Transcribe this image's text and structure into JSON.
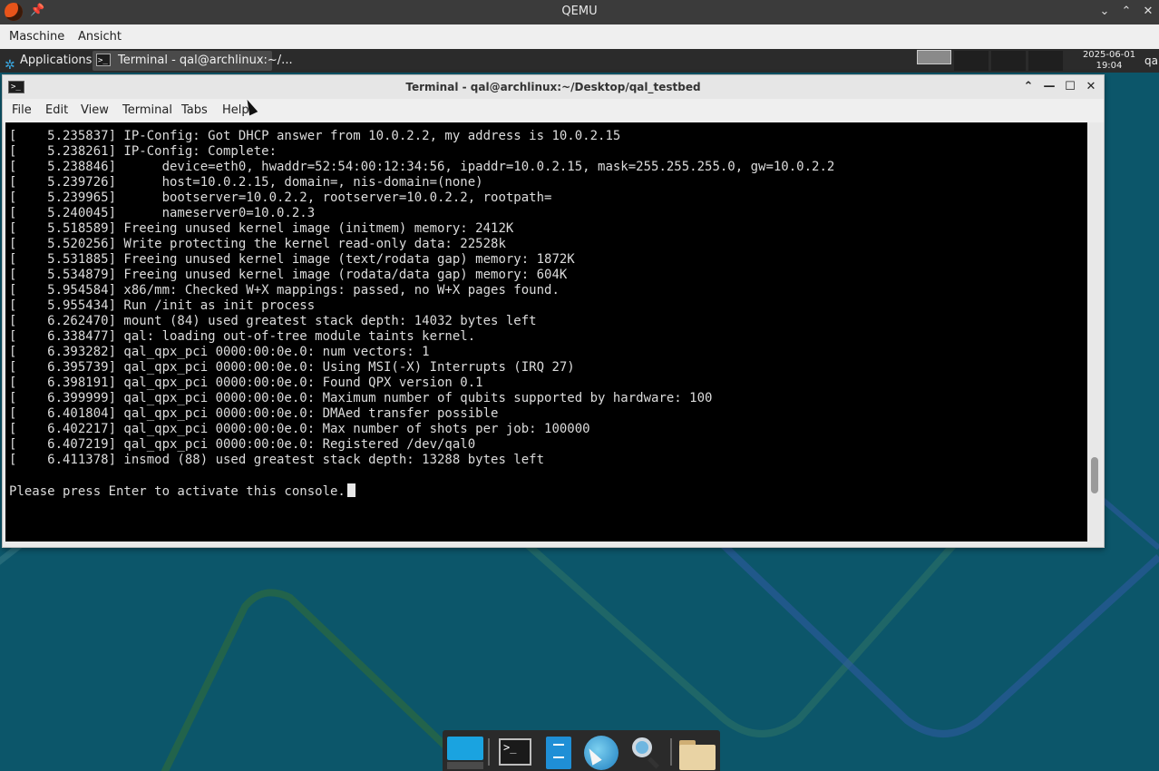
{
  "qemu": {
    "title": "QEMU",
    "pin_icon": "pin-icon",
    "menu": [
      "Maschine",
      "Ansicht"
    ],
    "controls": {
      "minimize": "⌄",
      "maximize": "⌃",
      "close": "✕"
    }
  },
  "panel": {
    "applications_label": "Applications",
    "task_label": "Terminal - qal@archlinux:~/...",
    "clock": {
      "date": "2025-06-01",
      "time": "19:04"
    },
    "user": "qa"
  },
  "terminal": {
    "title": "Terminal - qal@archlinux:~/Desktop/qal_testbed",
    "menu": [
      "File",
      "Edit",
      "View",
      "Terminal",
      "Tabs",
      "Help"
    ],
    "controls": {
      "shade": "⌃",
      "minimize": "—",
      "maximize": "☐",
      "close": "✕"
    },
    "lines": [
      "[    5.235837] IP-Config: Got DHCP answer from 10.0.2.2, my address is 10.0.2.15",
      "[    5.238261] IP-Config: Complete:",
      "[    5.238846]      device=eth0, hwaddr=52:54:00:12:34:56, ipaddr=10.0.2.15, mask=255.255.255.0, gw=10.0.2.2",
      "[    5.239726]      host=10.0.2.15, domain=, nis-domain=(none)",
      "[    5.239965]      bootserver=10.0.2.2, rootserver=10.0.2.2, rootpath=",
      "[    5.240045]      nameserver0=10.0.2.3",
      "[    5.518589] Freeing unused kernel image (initmem) memory: 2412K",
      "[    5.520256] Write protecting the kernel read-only data: 22528k",
      "[    5.531885] Freeing unused kernel image (text/rodata gap) memory: 1872K",
      "[    5.534879] Freeing unused kernel image (rodata/data gap) memory: 604K",
      "[    5.954584] x86/mm: Checked W+X mappings: passed, no W+X pages found.",
      "[    5.955434] Run /init as init process",
      "[    6.262470] mount (84) used greatest stack depth: 14032 bytes left",
      "[    6.338477] qal: loading out-of-tree module taints kernel.",
      "[    6.393282] qal_qpx_pci 0000:00:0e.0: num vectors: 1",
      "[    6.395739] qal_qpx_pci 0000:00:0e.0: Using MSI(-X) Interrupts (IRQ 27)",
      "[    6.398191] qal_qpx_pci 0000:00:0e.0: Found QPX version 0.1",
      "[    6.399999] qal_qpx_pci 0000:00:0e.0: Maximum number of qubits supported by hardware: 100",
      "[    6.401804] qal_qpx_pci 0000:00:0e.0: DMAed transfer possible",
      "[    6.402217] qal_qpx_pci 0000:00:0e.0: Max number of shots per job: 100000",
      "[    6.407219] qal_qpx_pci 0000:00:0e.0: Registered /dev/qal0",
      "[    6.411378] insmod (88) used greatest stack depth: 13288 bytes left",
      "",
      "Please press Enter to activate this console."
    ]
  },
  "dock": {
    "items": [
      "show-desktop-icon",
      "terminal-icon",
      "file-manager-icon",
      "web-browser-icon",
      "search-icon",
      "folder-icon"
    ]
  },
  "colors": {
    "desktop_bg": "#0c566a",
    "panel_bg": "#2b2b2b",
    "terminal_bg": "#000000",
    "terminal_fg": "#dcdcdc"
  }
}
